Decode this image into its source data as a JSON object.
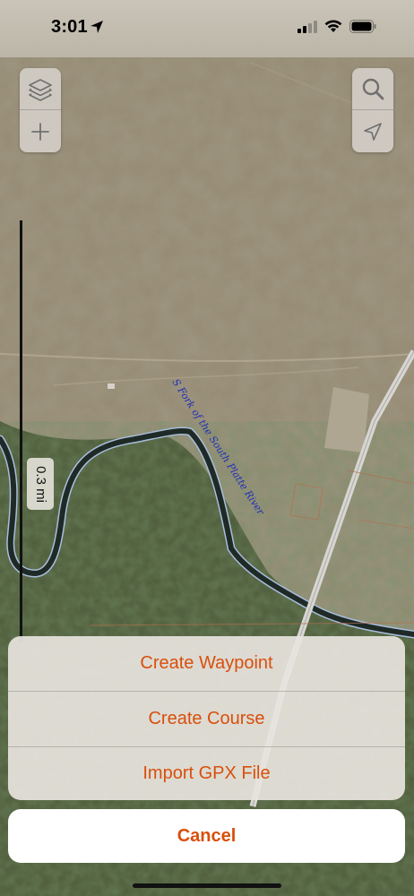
{
  "status_bar": {
    "time": "3:01",
    "location_icon": "location-arrow-icon",
    "signal_icon": "cellular-signal-icon",
    "wifi_icon": "wifi-icon",
    "battery_icon": "battery-icon"
  },
  "map": {
    "river_label": "S Fork of the South Platte River",
    "scale_label": "0.3 mi",
    "controls": {
      "layers_icon": "layers-icon",
      "zoom_in_icon": "plus-icon",
      "search_icon": "search-icon",
      "locate_icon": "navigation-arrow-icon"
    }
  },
  "action_sheet": {
    "items": [
      {
        "label": "Create Waypoint"
      },
      {
        "label": "Create Course"
      },
      {
        "label": "Import GPX File"
      }
    ],
    "cancel_label": "Cancel"
  },
  "colors": {
    "accent": "#d94f0c",
    "river_label": "#1e2fb8"
  }
}
